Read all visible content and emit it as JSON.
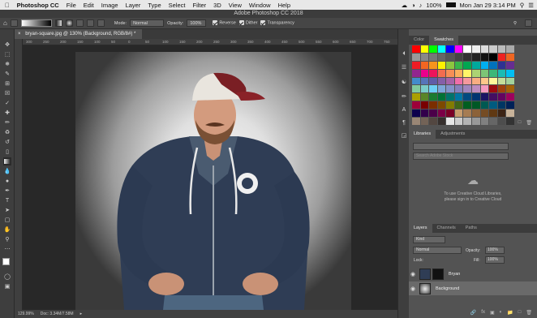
{
  "menubar": {
    "items": [
      "Photoshop CC",
      "File",
      "Edit",
      "Image",
      "Layer",
      "Type",
      "Select",
      "Filter",
      "3D",
      "View",
      "Window",
      "Help"
    ],
    "battery": "100%",
    "clock": "Mon Jan 29  3:14 PM"
  },
  "window": {
    "title": "Adobe Photoshop CC 2018"
  },
  "options": {
    "mode_label": "Mode:",
    "mode_value": "Normal",
    "opacity_label": "Opacity:",
    "opacity_value": "100%",
    "reverse_label": "Reverse",
    "dither_label": "Dither",
    "transparency_label": "Transparency"
  },
  "document": {
    "tab_title": "bryan-square.jpg @ 130% (Background, RGB/8#) *",
    "ruler_marks": [
      "300",
      "250",
      "200",
      "150",
      "100",
      "50",
      "0",
      "50",
      "100",
      "150",
      "200",
      "250",
      "300",
      "350",
      "400",
      "450",
      "500",
      "550",
      "600",
      "650",
      "700",
      "750"
    ]
  },
  "status": {
    "zoom": "129.99%",
    "doc": "Doc: 3.34M/7.58M"
  },
  "color_panel": {
    "tabs": [
      "Color",
      "Swatches"
    ],
    "active_tab": "Swatches",
    "swatch_colors": [
      "#ff0000",
      "#ffff00",
      "#00ff00",
      "#00ffff",
      "#0000ff",
      "#ff00ff",
      "#ffffff",
      "#eeeeee",
      "#dddddd",
      "#cccccc",
      "#bbbbbb",
      "#aaaaaa",
      "#999999",
      "#888888",
      "#777777",
      "#666666",
      "#555555",
      "#444444",
      "#333333",
      "#222222",
      "#111111",
      "#000000",
      "#ee2222",
      "#ee6622",
      "#ed1c24",
      "#f26522",
      "#f7941d",
      "#fff200",
      "#8dc63f",
      "#39b54a",
      "#00a651",
      "#00a99d",
      "#00aeef",
      "#0072bc",
      "#2e3192",
      "#662d91",
      "#92278f",
      "#ec008c",
      "#ed145b",
      "#f26c4f",
      "#f68e56",
      "#fbaf5d",
      "#fff568",
      "#acd373",
      "#7cc576",
      "#3cb878",
      "#1cbbb4",
      "#00bff3",
      "#438ccb",
      "#5674b9",
      "#605ca8",
      "#855fa8",
      "#a763a8",
      "#f06ea9",
      "#f6989d",
      "#f9ad81",
      "#fdc68a",
      "#fff79a",
      "#c4df9b",
      "#a3d39c",
      "#82ca9d",
      "#7accc8",
      "#6dcff6",
      "#7da7d9",
      "#8393ca",
      "#8781bd",
      "#a186be",
      "#bd8cbf",
      "#f49ac1",
      "#9e0b0f",
      "#a0410d",
      "#a36209",
      "#aba000",
      "#598527",
      "#1a7b30",
      "#007236",
      "#00746b",
      "#0076a3",
      "#004a80",
      "#003471",
      "#1b1464",
      "#440e62",
      "#630460",
      "#9e005d",
      "#9e0039",
      "#790000",
      "#7b2e00",
      "#7d4900",
      "#827b00",
      "#406618",
      "#005e20",
      "#005826",
      "#005952",
      "#005b7f",
      "#003663",
      "#002157",
      "#0d004c",
      "#32004b",
      "#4b0049",
      "#7b0046",
      "#7a0026",
      "#c69c6d",
      "#a67c52",
      "#8c6239",
      "#754c24",
      "#603913",
      "#3c2415",
      "#c7b299",
      "#998675",
      "#736357",
      "#534741",
      "#362f2d",
      "#e6e6e6",
      "#cccccc",
      "#b3b3b3",
      "#999999",
      "#808080",
      "#666666",
      "#4d4d4d",
      "#333333"
    ]
  },
  "libraries": {
    "tabs": [
      "Libraries",
      "Adjustments"
    ],
    "active_tab": "Libraries",
    "search_placeholder": "Search Adobe Stock",
    "message_line1": "To use Creative Cloud Libraries,",
    "message_line2": "please sign in to Creative Cloud"
  },
  "layers": {
    "tabs": [
      "Layers",
      "Channels",
      "Paths"
    ],
    "active_tab": "Layers",
    "kind_label": "Kind",
    "blend_mode": "Normal",
    "opacity_label": "Opacity:",
    "opacity_value": "100%",
    "lock_label": "Lock:",
    "fill_label": "Fill:",
    "fill_value": "100%",
    "items": [
      {
        "name": "Bryan",
        "visible": true
      },
      {
        "name": "Background",
        "visible": true
      }
    ]
  },
  "colors": {
    "menubar_bg": "#e8e8e8",
    "panel_bg": "#535353",
    "dark_bg": "#282828"
  }
}
